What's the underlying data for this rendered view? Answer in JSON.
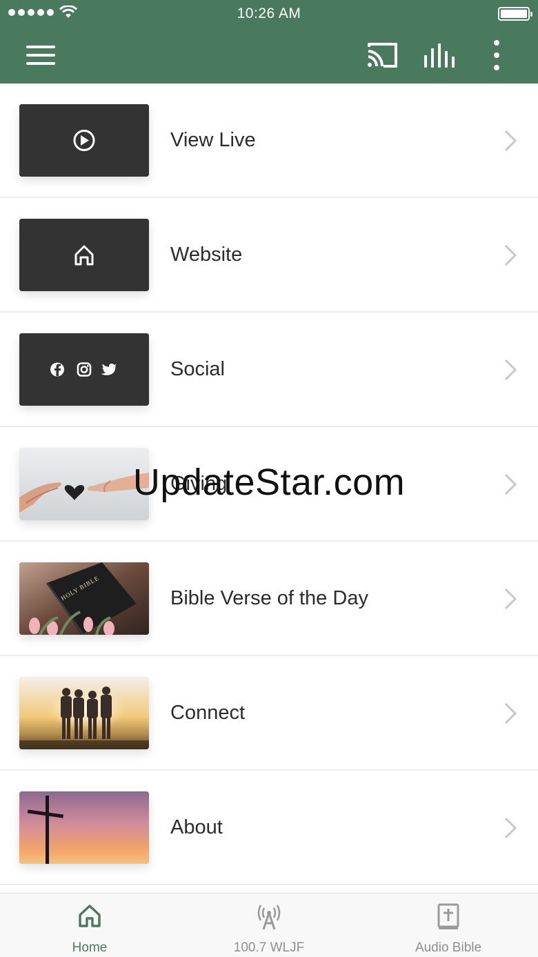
{
  "status_bar": {
    "time": "10:26 AM"
  },
  "nav": {
    "icons": [
      "menu-icon",
      "cast-icon",
      "equalizer-icon",
      "more-vertical-icon"
    ],
    "color": "#4a7a5e"
  },
  "menu": {
    "items": [
      {
        "label": "View Live",
        "thumbnail": "play-icon"
      },
      {
        "label": "Website",
        "thumbnail": "home-icon"
      },
      {
        "label": "Social",
        "thumbnail": "social-icons"
      },
      {
        "label": "Giving",
        "thumbnail": "photo-hands-heart"
      },
      {
        "label": "Bible Verse of the Day",
        "thumbnail": "photo-holy-bible",
        "image_text": "HOLY BIBLE"
      },
      {
        "label": "Connect",
        "thumbnail": "photo-friends-sunset"
      },
      {
        "label": "About",
        "thumbnail": "photo-cross-sky"
      }
    ]
  },
  "watermark": "UpdateStar.com",
  "tabs": [
    {
      "label": "Home",
      "icon": "home-icon",
      "active": true
    },
    {
      "label": "100.7 WLJF",
      "icon": "radio-tower-icon",
      "active": false
    },
    {
      "label": "Audio Bible",
      "icon": "bible-icon",
      "active": false
    }
  ],
  "colors": {
    "accent": "#4a7a5e",
    "tab_inactive": "#8e8e8e",
    "tile_dark": "#333333"
  }
}
